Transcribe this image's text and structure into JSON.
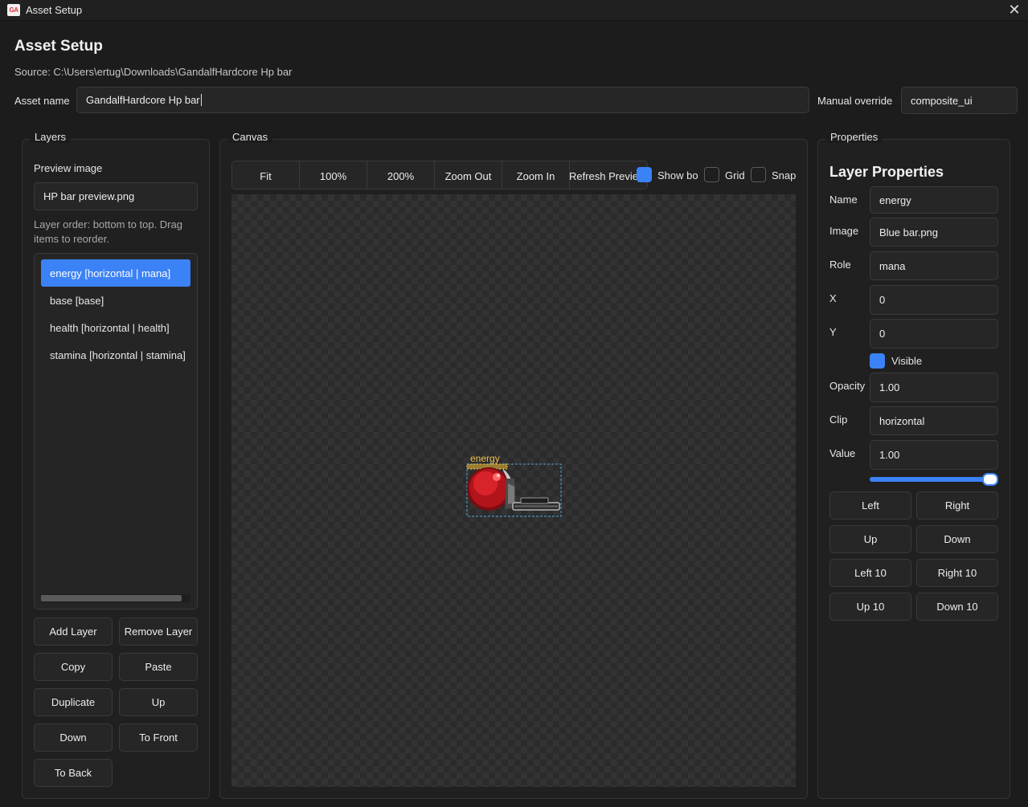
{
  "window": {
    "title": "Asset Setup",
    "icon_text": "GA"
  },
  "header": {
    "heading": "Asset Setup",
    "source": "Source: C:\\Users\\ertug\\Downloads\\GandalfHardcore Hp bar",
    "asset_name_label": "Asset name",
    "asset_name_value": "GandalfHardcore Hp bar",
    "manual_override_label": "Manual override",
    "manual_override_value": "composite_ui"
  },
  "layers": {
    "title": "Layers",
    "preview_label": "Preview image",
    "preview_value": "HP bar preview.png",
    "hint": "Layer order: bottom to top. Drag items to reorder.",
    "items": [
      {
        "label": "energy  [horizontal | mana]"
      },
      {
        "label": "base  [base]"
      },
      {
        "label": "health  [horizontal | health]"
      },
      {
        "label": "stamina  [horizontal | stamina]"
      }
    ],
    "selected_index": 0,
    "buttons": {
      "add": "Add Layer",
      "remove": "Remove Layer",
      "copy": "Copy",
      "paste": "Paste",
      "duplicate": "Duplicate",
      "up": "Up",
      "down": "Down",
      "to_front": "To Front",
      "to_back": "To Back"
    }
  },
  "canvas": {
    "title": "Canvas",
    "toolbar": {
      "fit": "Fit",
      "zoom100": "100%",
      "zoom200": "200%",
      "zoom_out": "Zoom Out",
      "zoom_in": "Zoom In",
      "refresh": "Refresh Preview"
    },
    "show_bounds_label": "Show bo",
    "show_bounds_checked": true,
    "grid_label": "Grid",
    "grid_checked": false,
    "snap_label": "Snap",
    "snap_checked": false,
    "selected_layer_label": "energy"
  },
  "properties": {
    "title": "Properties",
    "heading": "Layer Properties",
    "name_label": "Name",
    "name_value": "energy",
    "image_label": "Image",
    "image_value": "Blue bar.png",
    "role_label": "Role",
    "role_value": "mana",
    "x_label": "X",
    "x_value": "0",
    "y_label": "Y",
    "y_value": "0",
    "visible_label": "Visible",
    "visible_checked": true,
    "opacity_label": "Opacity",
    "opacity_value": "1.00",
    "clip_label": "Clip",
    "clip_value": "horizontal",
    "value_label": "Value",
    "value_value": "1.00",
    "value_slider": 1.0,
    "buttons": {
      "left": "Left",
      "right": "Right",
      "up": "Up",
      "down": "Down",
      "left10": "Left 10",
      "right10": "Right 10",
      "up10": "Up 10",
      "down10": "Down 10"
    }
  },
  "colors": {
    "accent": "#3b82f6",
    "background": "#1c1c1c",
    "panel": "#202020",
    "layer_label": "#f0c050",
    "bounds": "#4aa8d8"
  }
}
